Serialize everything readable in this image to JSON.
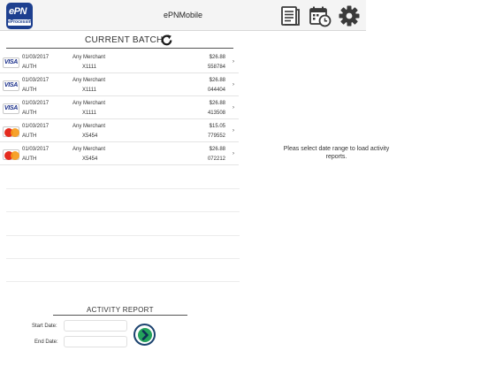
{
  "app": {
    "title": "ePNMobile",
    "logo_text": "ePN",
    "logo_subtext": "eProcessing"
  },
  "nav_icons": [
    "report-icon",
    "calendar-clock-icon",
    "gear-icon"
  ],
  "batch": {
    "title": "CURRENT BATCH",
    "transactions": [
      {
        "card": "visa",
        "card_label": "VISA",
        "date": "01/03/2017",
        "type": "AUTH",
        "merchant": "Any Merchant",
        "card_last4": "X1111",
        "amount": "$26.88",
        "ref": "558784"
      },
      {
        "card": "visa",
        "card_label": "VISA",
        "date": "01/03/2017",
        "type": "AUTH",
        "merchant": "Any Merchant",
        "card_last4": "X1111",
        "amount": "$26.88",
        "ref": "044404"
      },
      {
        "card": "visa",
        "card_label": "VISA",
        "date": "01/03/2017",
        "type": "AUTH",
        "merchant": "Any Merchant",
        "card_last4": "X1111",
        "amount": "$26.88",
        "ref": "413508"
      },
      {
        "card": "mastercard",
        "card_label": "",
        "date": "01/03/2017",
        "type": "AUTH",
        "merchant": "Any Merchant",
        "card_last4": "X5454",
        "amount": "$15.05",
        "ref": "779552"
      },
      {
        "card": "mastercard",
        "card_label": "",
        "date": "01/03/2017",
        "type": "AUTH",
        "merchant": "Any Merchant",
        "card_last4": "X5454",
        "amount": "$26.88",
        "ref": "072212"
      }
    ]
  },
  "report": {
    "title": "ACTIVITY REPORT",
    "start_label": "Start Date:",
    "end_label": "End Date:",
    "start_value": "",
    "end_value": ""
  },
  "detail": {
    "message": "Pleas select date range to load activity reports."
  },
  "colors": {
    "go_ring": "#1d4470",
    "go_fill": "#23a25b",
    "logo_bg": "#1d3f8f"
  }
}
